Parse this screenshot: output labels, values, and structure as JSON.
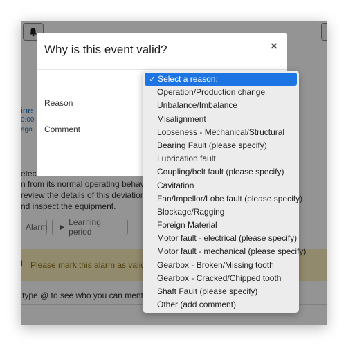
{
  "background": {
    "link_partial": "ine",
    "time_partial": "0:00",
    "ago_partial": "ago",
    "lines": [
      "etec",
      "n from its normal operating behavio",
      "review the details of this deviation c",
      "nd inspect the equipment."
    ],
    "alarm_button": "Alarm",
    "learning_button": "Learning period",
    "warning_text": "Please mark this alarm as valid or",
    "mention_text": "type @ to see who you can mention"
  },
  "modal": {
    "title": "Why is this event valid?",
    "reason_label": "Reason",
    "comment_label": "Comment",
    "close_glyph": "×"
  },
  "dropdown": {
    "selected_index": 0,
    "checkmark": "✓",
    "options": [
      "Select a reason:",
      "Operation/Production change",
      "Unbalance/Imbalance",
      "Misalignment",
      "Looseness - Mechanical/Structural",
      "Bearing Fault (please specify)",
      "Lubrication fault",
      "Coupling/belt fault (please specify)",
      "Cavitation",
      "Fan/Impellor/Lobe fault (please specify)",
      "Blockage/Ragging",
      "Foreign Material",
      "Motor fault - electrical (please specify)",
      "Motor fault - mechanical (please specify)",
      "Gearbox - Broken/Missing tooth",
      "Gearbox - Cracked/Chipped tooth",
      "Shaft Fault (please specify)",
      "Other (add comment)"
    ]
  },
  "colors": {
    "selected": "#1d74e3",
    "link": "#1a73c8",
    "warning_bg": "#fbeeba"
  }
}
